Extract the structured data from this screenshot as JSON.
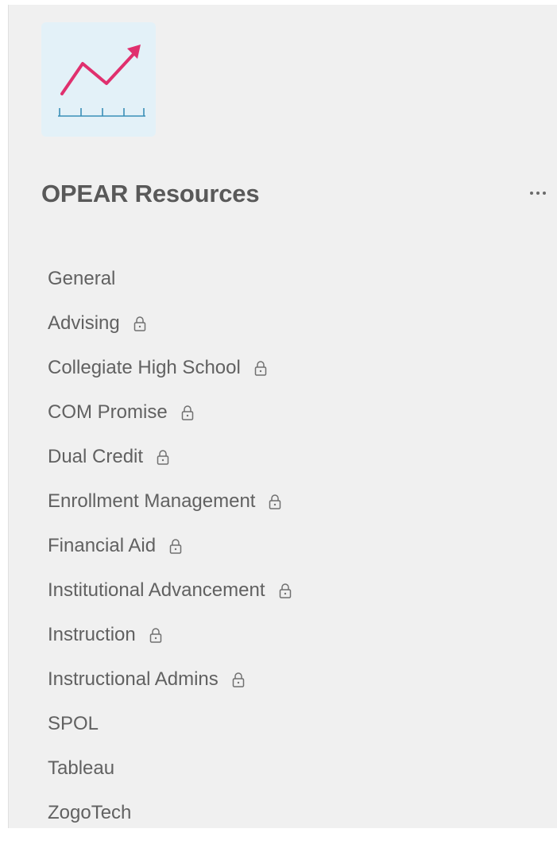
{
  "team": {
    "name": "OPEAR Resources",
    "logo_icon": "trend-chart-icon",
    "more_icon": "more-options-icon"
  },
  "channels": [
    {
      "label": "General",
      "locked": false
    },
    {
      "label": "Advising",
      "locked": true
    },
    {
      "label": "Collegiate High School",
      "locked": true
    },
    {
      "label": "COM Promise",
      "locked": true
    },
    {
      "label": "Dual Credit",
      "locked": true
    },
    {
      "label": "Enrollment Management",
      "locked": true
    },
    {
      "label": "Financial Aid",
      "locked": true
    },
    {
      "label": "Institutional Advancement",
      "locked": true
    },
    {
      "label": "Instruction",
      "locked": true
    },
    {
      "label": "Instructional Admins",
      "locked": true
    },
    {
      "label": "SPOL",
      "locked": false
    },
    {
      "label": "Tableau",
      "locked": false
    },
    {
      "label": "ZogoTech",
      "locked": false
    }
  ],
  "colors": {
    "panel_background": "#f0f0f0",
    "logo_background": "#e3f1f8",
    "logo_line": "#e0306e",
    "logo_axis": "#3a8fb7",
    "text": "#616161",
    "title": "#595959"
  }
}
